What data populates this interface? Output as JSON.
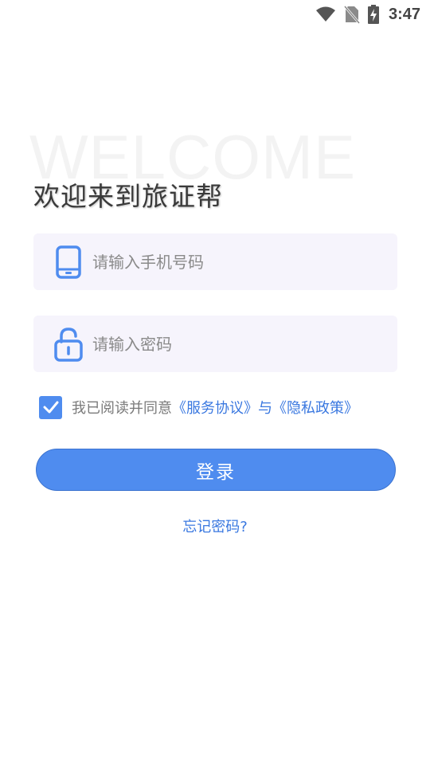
{
  "status_bar": {
    "time": "3:47",
    "icons": [
      "wifi-icon",
      "no-sim-icon",
      "battery-charging-icon"
    ]
  },
  "header": {
    "watermark": "WELCOME",
    "title": "欢迎来到旅证帮"
  },
  "form": {
    "phone": {
      "icon": "phone-icon",
      "value": "",
      "placeholder": "请输入手机号码"
    },
    "password": {
      "icon": "lock-icon",
      "value": "",
      "placeholder": "请输入密码"
    },
    "agreement": {
      "checked": true,
      "prefix": "我已阅读并同意",
      "service_link": "《服务协议》",
      "connector": "与",
      "privacy_link": "《隐私政策》"
    },
    "login_label": "登录",
    "forgot_label": "忘记密码?"
  },
  "colors": {
    "accent": "#4f8cef",
    "link": "#3a78e0",
    "field_bg": "#f6f4fc"
  }
}
